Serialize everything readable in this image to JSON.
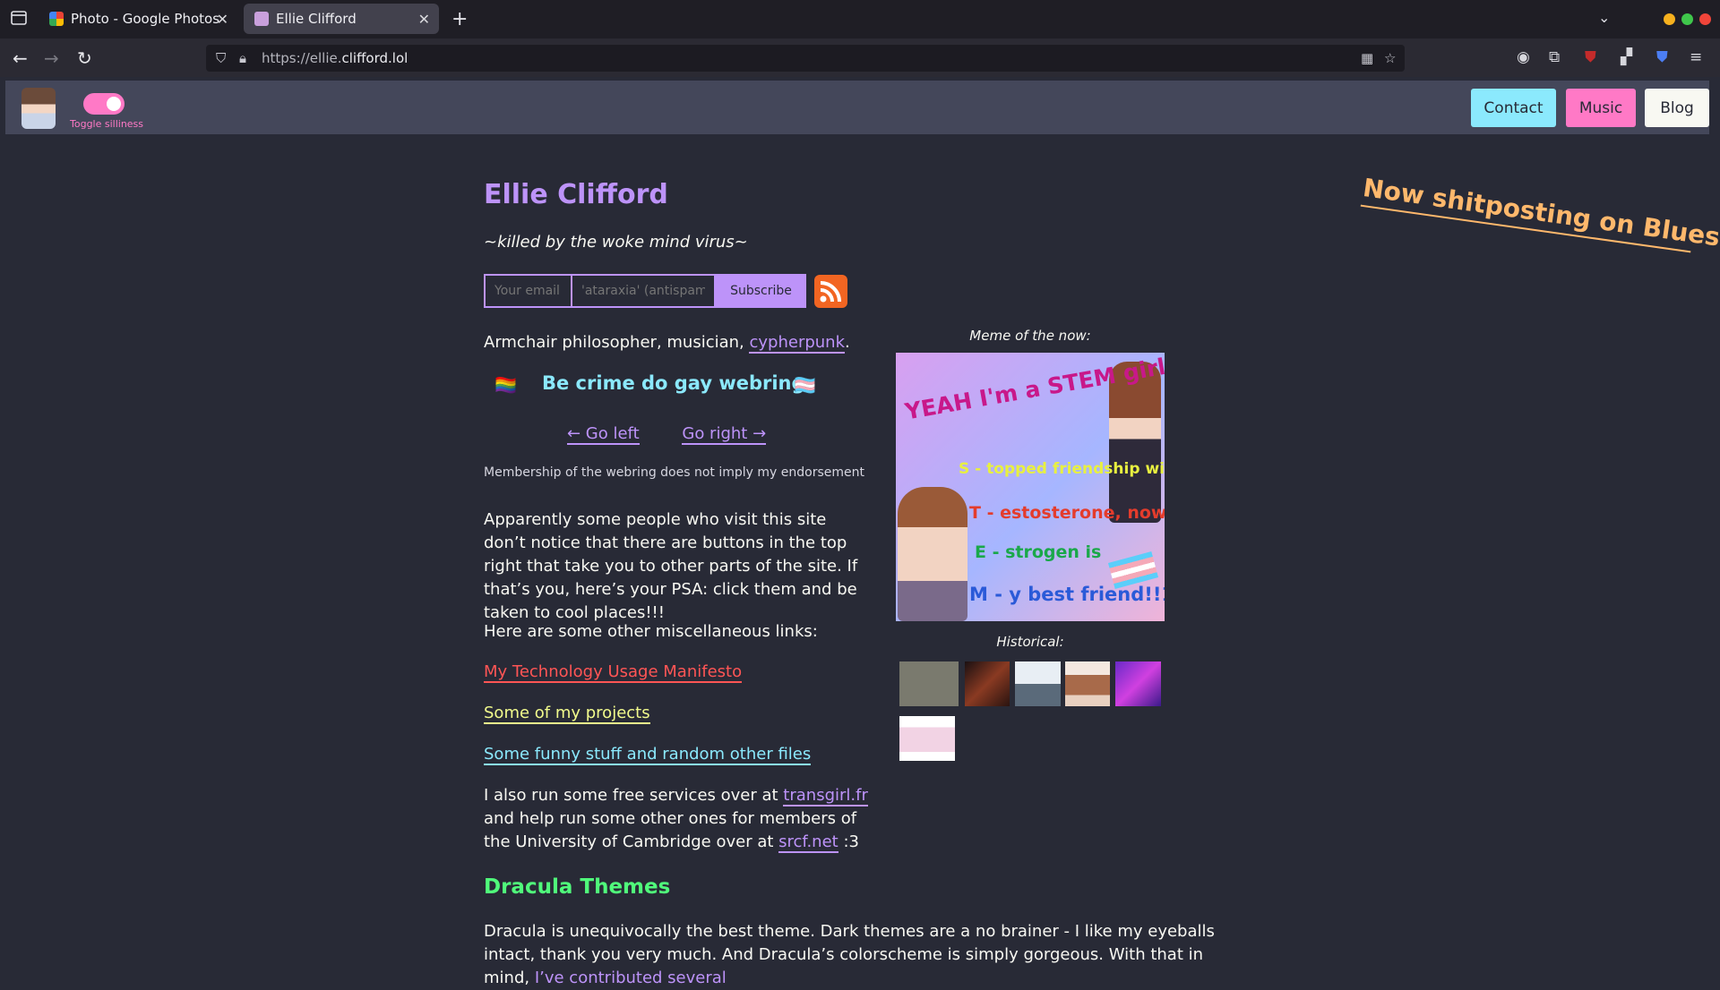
{
  "browser": {
    "tabs": [
      {
        "title": "Photo - Google Photos",
        "active": false
      },
      {
        "title": "Ellie Clifford",
        "active": true
      }
    ],
    "url_prefix": "https://ellie.",
    "url_domain": "clifford.lol",
    "new_tab": "+"
  },
  "header": {
    "toggle_label": "Toggle silliness",
    "nav": {
      "contact": "Contact",
      "music": "Music",
      "blog": "Blog"
    }
  },
  "banner": "Now shitposting on Bluesky",
  "main": {
    "title": "Ellie Clifford",
    "tagline": "~killed by the woke mind virus~",
    "subscribe": {
      "email_placeholder": "Your email",
      "antispam_placeholder": "'ataraxia' (antispam)",
      "button": "Subscribe"
    },
    "intro_text": "Armchair philosopher, musician, ",
    "intro_link": "cypherpunk",
    "intro_end": ".",
    "webring": {
      "title": "Be crime do gay webring",
      "left": "← Go left",
      "right": "Go right →",
      "note": "Membership of the webring does not imply my endorsement"
    },
    "psa": "Apparently some people who visit this site don’t notice that there are buttons in the top right that take you to other parts of the site. If that’s you, here’s your PSA: click them and be taken to cool places!!!",
    "misc_intro": "Here are some other miscellaneous links:",
    "links": {
      "manifesto": "My Technology Usage Manifesto",
      "projects": "Some of my projects",
      "funny": "Some funny stuff and random other files"
    },
    "services": {
      "part1": "I also run some free services over at ",
      "link1": "transgirl.fr",
      "part2": " and help run some other ones for members of the University of Cambridge over at ",
      "link2": "srcf.net",
      "part3": " :3"
    },
    "dracula": {
      "heading": "Dracula Themes",
      "text": "Dracula is unequivocally the best theme. Dark themes are a no brainer - I like my eyeballs intact, thank you very much. And Dracula’s colorscheme is simply gorgeous. With that in mind, ",
      "link": "I’ve contributed several"
    }
  },
  "meme": {
    "caption": "Meme of the now:",
    "lines": [
      "YEAH I'm a STEM girl",
      "S - topped friendship with",
      "T - estosterone, now",
      "E - strogen is",
      "M - y best friend!!1!"
    ],
    "historical_caption": "Historical:"
  },
  "colors": {
    "background": "#282a36",
    "purple": "#bd93f9",
    "pink": "#ff79c6",
    "cyan": "#8be9fd",
    "green": "#50fa7b",
    "orange": "#ffb86c",
    "red": "#ff5555",
    "yellow": "#f1fa8c"
  }
}
